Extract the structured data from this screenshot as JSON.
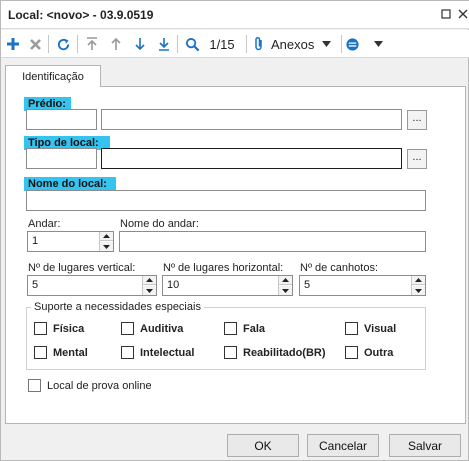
{
  "window": {
    "title": "Local: <novo> - 03.9.0519"
  },
  "toolbar": {
    "add_icon": "plus-icon",
    "delete_icon": "x-icon",
    "refresh_icon": "refresh-icon",
    "first_icon": "arrow-to-top-icon",
    "prev_icon": "arrow-up-icon",
    "next_icon": "arrow-down-icon",
    "last_icon": "arrow-to-bottom-icon",
    "search_icon": "search-icon",
    "record_position": "1/15",
    "attachments_label": "Anexos",
    "accent_color": "#1a73c6"
  },
  "tabs": [
    {
      "label": "Identificação"
    }
  ],
  "form": {
    "predio": {
      "label": "Prédio:",
      "code": "",
      "name": "",
      "lookup_label": "..."
    },
    "tipo_local": {
      "label": "Tipo de local:",
      "code": "",
      "name": "",
      "lookup_label": "..."
    },
    "nome_local": {
      "label": "Nome do local:",
      "value": ""
    },
    "andar": {
      "label": "Andar:",
      "value": "1"
    },
    "nome_andar": {
      "label": "Nome do andar:",
      "value": ""
    },
    "lugares_vertical": {
      "label": "Nº de lugares vertical:",
      "value": "5"
    },
    "lugares_horizontal": {
      "label": "Nº de lugares horizontal:",
      "value": "10"
    },
    "canhotos": {
      "label": "Nº de canhotos:",
      "value": "5"
    },
    "highlight_color": "#33c4f0"
  },
  "suporte": {
    "title": "Suporte a necessidades especiais",
    "options": [
      {
        "label": "Física",
        "checked": false
      },
      {
        "label": "Auditiva",
        "checked": false
      },
      {
        "label": "Fala",
        "checked": false
      },
      {
        "label": "Visual",
        "checked": false
      },
      {
        "label": "Mental",
        "checked": false
      },
      {
        "label": "Intelectual",
        "checked": false
      },
      {
        "label": "Reabilitado(BR)",
        "checked": false
      },
      {
        "label": "Outra",
        "checked": false
      }
    ]
  },
  "prova_online": {
    "label": "Local de prova online",
    "checked": false
  },
  "buttons": {
    "ok": "OK",
    "cancel": "Cancelar",
    "save": "Salvar"
  }
}
